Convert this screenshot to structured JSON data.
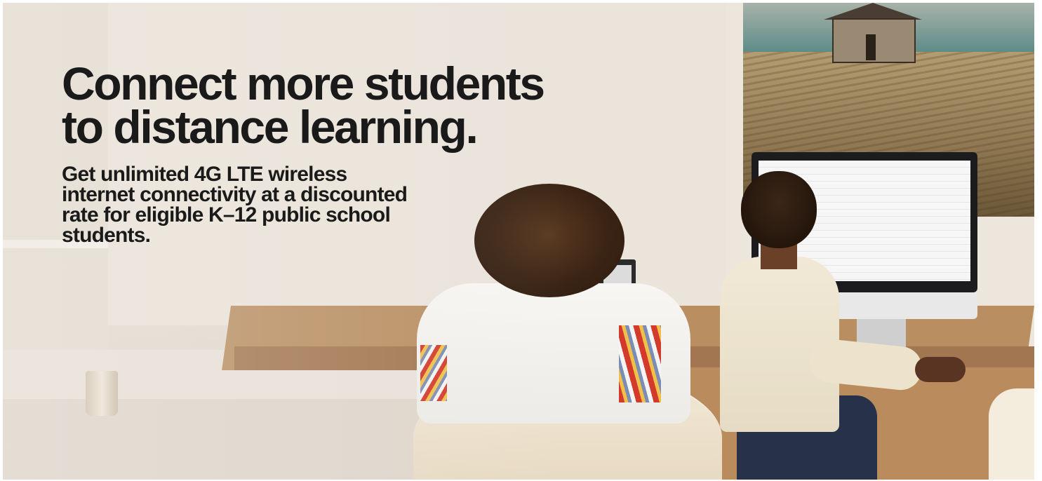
{
  "hero": {
    "headline": "Connect more students to distance learning.",
    "subheadline": "Get unlimited 4G LTE wireless internet connectivity at a discounted rate for eligible K–12 public school students."
  },
  "colors": {
    "text": "#1a1a1a",
    "wall": "#ebe4db",
    "desk_wood": "#b98f62"
  }
}
